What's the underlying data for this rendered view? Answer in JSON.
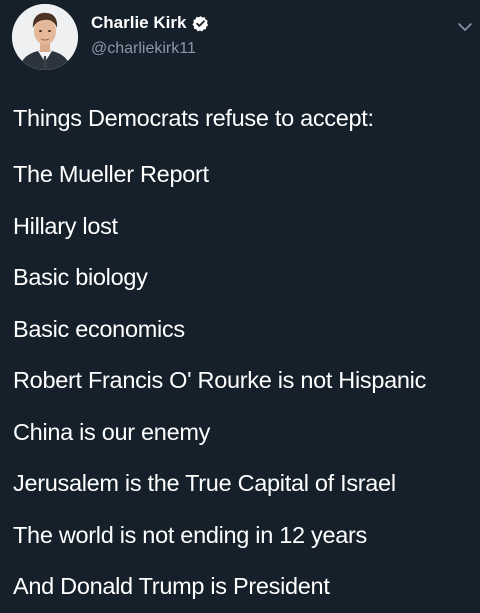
{
  "author": {
    "display_name": "Charlie Kirk",
    "handle": "@charliekirk11",
    "verified": true,
    "avatar_icon": "profile-photo",
    "verified_icon": "verified-badge-icon"
  },
  "menu_icon": "chevron-down-icon",
  "tweet": {
    "lines": [
      "Things Democrats refuse to accept:",
      "The Mueller Report",
      "Hillary lost",
      "Basic biology",
      "Basic economics",
      "Robert Francis O' Rourke is not Hispanic",
      "China is our enemy",
      "Jerusalem is the True Capital of Israel",
      "The world is not ending in 12 years",
      "And Donald Trump is President"
    ]
  },
  "colors": {
    "background": "#15202b",
    "text": "#ffffff",
    "secondary_text": "#8899a6"
  }
}
